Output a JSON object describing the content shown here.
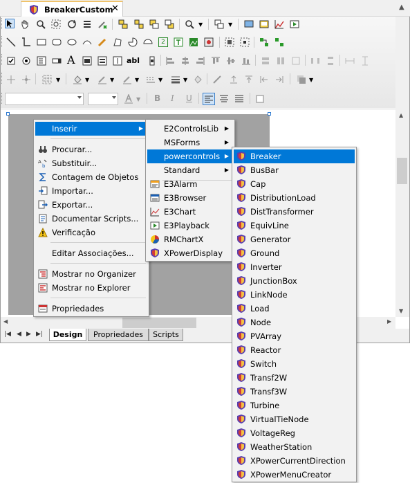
{
  "tab": {
    "title": "BreakerCustom",
    "close": "✕"
  },
  "sheet_tabs": [
    "Design",
    "Propriedades",
    "Scripts"
  ],
  "context_menu": {
    "items": [
      {
        "label": "Inserir",
        "has_submenu": true,
        "highlighted": true,
        "icon": "none"
      },
      {
        "label": "Procurar...",
        "icon": "binoculars-icon"
      },
      {
        "label": "Substituir...",
        "icon": "replace-icon"
      },
      {
        "label": "Contagem de Objetos",
        "icon": "sigma-icon"
      },
      {
        "label": "Importar...",
        "icon": "import-icon"
      },
      {
        "label": "Exportar...",
        "icon": "export-icon"
      },
      {
        "label": "Documentar Scripts...",
        "icon": "document-scripts-icon"
      },
      {
        "label": "Verificação",
        "icon": "warning-icon"
      },
      {
        "label": "Editar Associações...",
        "icon": "none"
      },
      {
        "label": "Mostrar no Organizer",
        "icon": "organizer-icon"
      },
      {
        "label": "Mostrar no Explorer",
        "icon": "explorer-icon"
      },
      {
        "label": "Propriedades",
        "icon": "properties-icon"
      }
    ]
  },
  "insert_submenu": {
    "items": [
      {
        "label": "E2ControlsLib",
        "has_submenu": true
      },
      {
        "label": "MSForms",
        "has_submenu": true
      },
      {
        "label": "powercontrols",
        "has_submenu": true,
        "highlighted": true
      },
      {
        "label": "Standard",
        "has_submenu": true
      },
      {
        "label": "E3Alarm",
        "icon": "e3alarm-icon"
      },
      {
        "label": "E3Browser",
        "icon": "e3browser-icon"
      },
      {
        "label": "E3Chart",
        "icon": "e3chart-icon"
      },
      {
        "label": "E3Playback",
        "icon": "e3playback-icon"
      },
      {
        "label": "RMChartX",
        "icon": "rmchart-icon"
      },
      {
        "label": "XPowerDisplay",
        "icon": "shield-icon"
      }
    ]
  },
  "powercontrols_submenu": {
    "items": [
      "Breaker",
      "BusBar",
      "Cap",
      "DistributionLoad",
      "DistTransformer",
      "EquivLine",
      "Generator",
      "Ground",
      "Inverter",
      "JunctionBox",
      "LinkNode",
      "Load",
      "Node",
      "PVArray",
      "Reactor",
      "Switch",
      "Transf2W",
      "Transf3W",
      "Turbine",
      "VirtualTieNode",
      "VoltageReg",
      "WeatherStation",
      "XPowerCurrentDirection",
      "XPowerMenuCreator"
    ],
    "highlighted": "Breaker"
  },
  "toolbar": {
    "italic": "I",
    "bold": "B",
    "underline": "U",
    "text_A": "A",
    "label_ab": "abl",
    "num_2": "2"
  },
  "colors": {
    "highlight": "#0078d7",
    "menu_bg": "#f2f2f2",
    "canvas_gray": "#a2a2a2"
  }
}
